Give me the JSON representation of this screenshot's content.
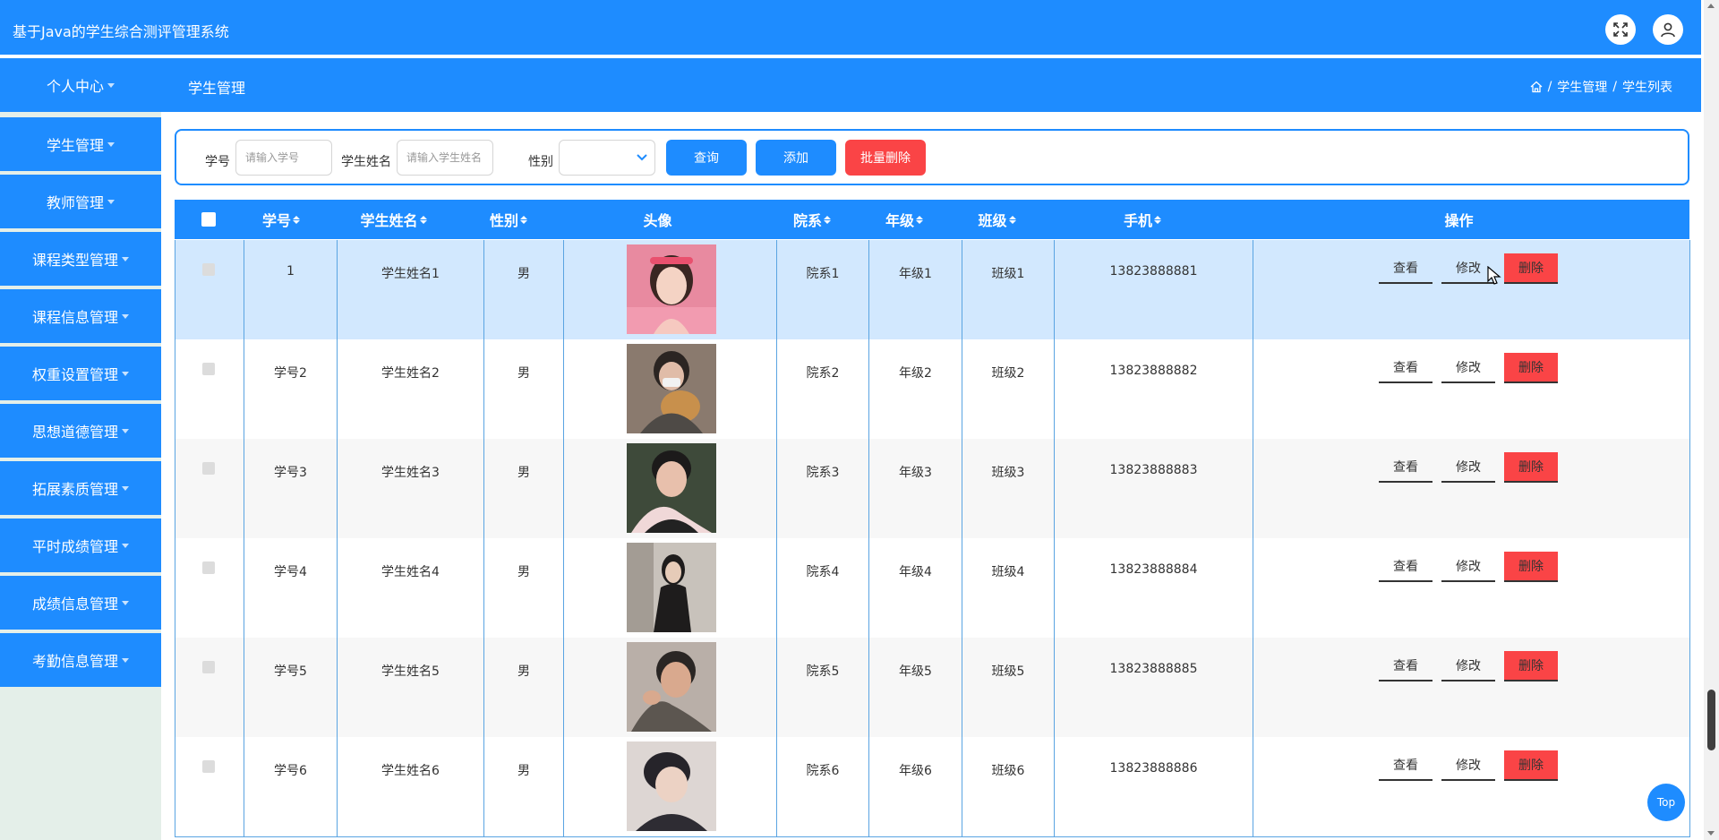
{
  "app": {
    "title": "基于Java的学生综合测评管理系统",
    "fullscreen_icon": "expand-icon",
    "user_icon": "user-icon"
  },
  "nav": {
    "personal_center": "个人中心",
    "page_title": "学生管理",
    "breadcrumb": {
      "home_icon": "home-icon",
      "sep": "/",
      "level1": "学生管理",
      "level2": "学生列表"
    }
  },
  "sidebar": {
    "items": [
      {
        "label": "学生管理"
      },
      {
        "label": "教师管理"
      },
      {
        "label": "课程类型管理"
      },
      {
        "label": "课程信息管理"
      },
      {
        "label": "权重设置管理"
      },
      {
        "label": "思想道德管理"
      },
      {
        "label": "拓展素质管理"
      },
      {
        "label": "平时成绩管理"
      },
      {
        "label": "成绩信息管理"
      },
      {
        "label": "考勤信息管理"
      }
    ]
  },
  "search": {
    "student_no_label": "学号",
    "student_no_placeholder": "请输入学号",
    "student_name_label": "学生姓名",
    "student_name_placeholder": "请输入学生姓名",
    "gender_label": "性别",
    "gender_value": "",
    "query_button": "查询",
    "add_button": "添加",
    "batch_delete_button": "批量删除"
  },
  "table": {
    "columns": [
      "学号",
      "学生姓名",
      "性别",
      "头像",
      "院系",
      "年级",
      "班级",
      "手机",
      "操作"
    ],
    "actions": {
      "view": "查看",
      "edit": "修改",
      "delete": "删除"
    },
    "rows": [
      {
        "no": "1",
        "name": "学生姓名1",
        "gender": "男",
        "dept": "院系1",
        "grade": "年级1",
        "cls": "班级1",
        "phone": "13823888881"
      },
      {
        "no": "学号2",
        "name": "学生姓名2",
        "gender": "男",
        "dept": "院系2",
        "grade": "年级2",
        "cls": "班级2",
        "phone": "13823888882"
      },
      {
        "no": "学号3",
        "name": "学生姓名3",
        "gender": "男",
        "dept": "院系3",
        "grade": "年级3",
        "cls": "班级3",
        "phone": "13823888883"
      },
      {
        "no": "学号4",
        "name": "学生姓名4",
        "gender": "男",
        "dept": "院系4",
        "grade": "年级4",
        "cls": "班级4",
        "phone": "13823888884"
      },
      {
        "no": "学号5",
        "name": "学生姓名5",
        "gender": "男",
        "dept": "院系5",
        "grade": "年级5",
        "cls": "班级5",
        "phone": "13823888885"
      },
      {
        "no": "学号6",
        "name": "学生姓名6",
        "gender": "男",
        "dept": "院系6",
        "grade": "年级6",
        "cls": "班级6",
        "phone": "13823888886"
      }
    ]
  },
  "back_to_top": "Top",
  "colors": {
    "primary": "#1e8cff",
    "danger": "#fa4446",
    "row_highlight": "#d2e8fe",
    "row_alt": "#f7f7f7",
    "sidebar_bg": "#e4efe9"
  }
}
